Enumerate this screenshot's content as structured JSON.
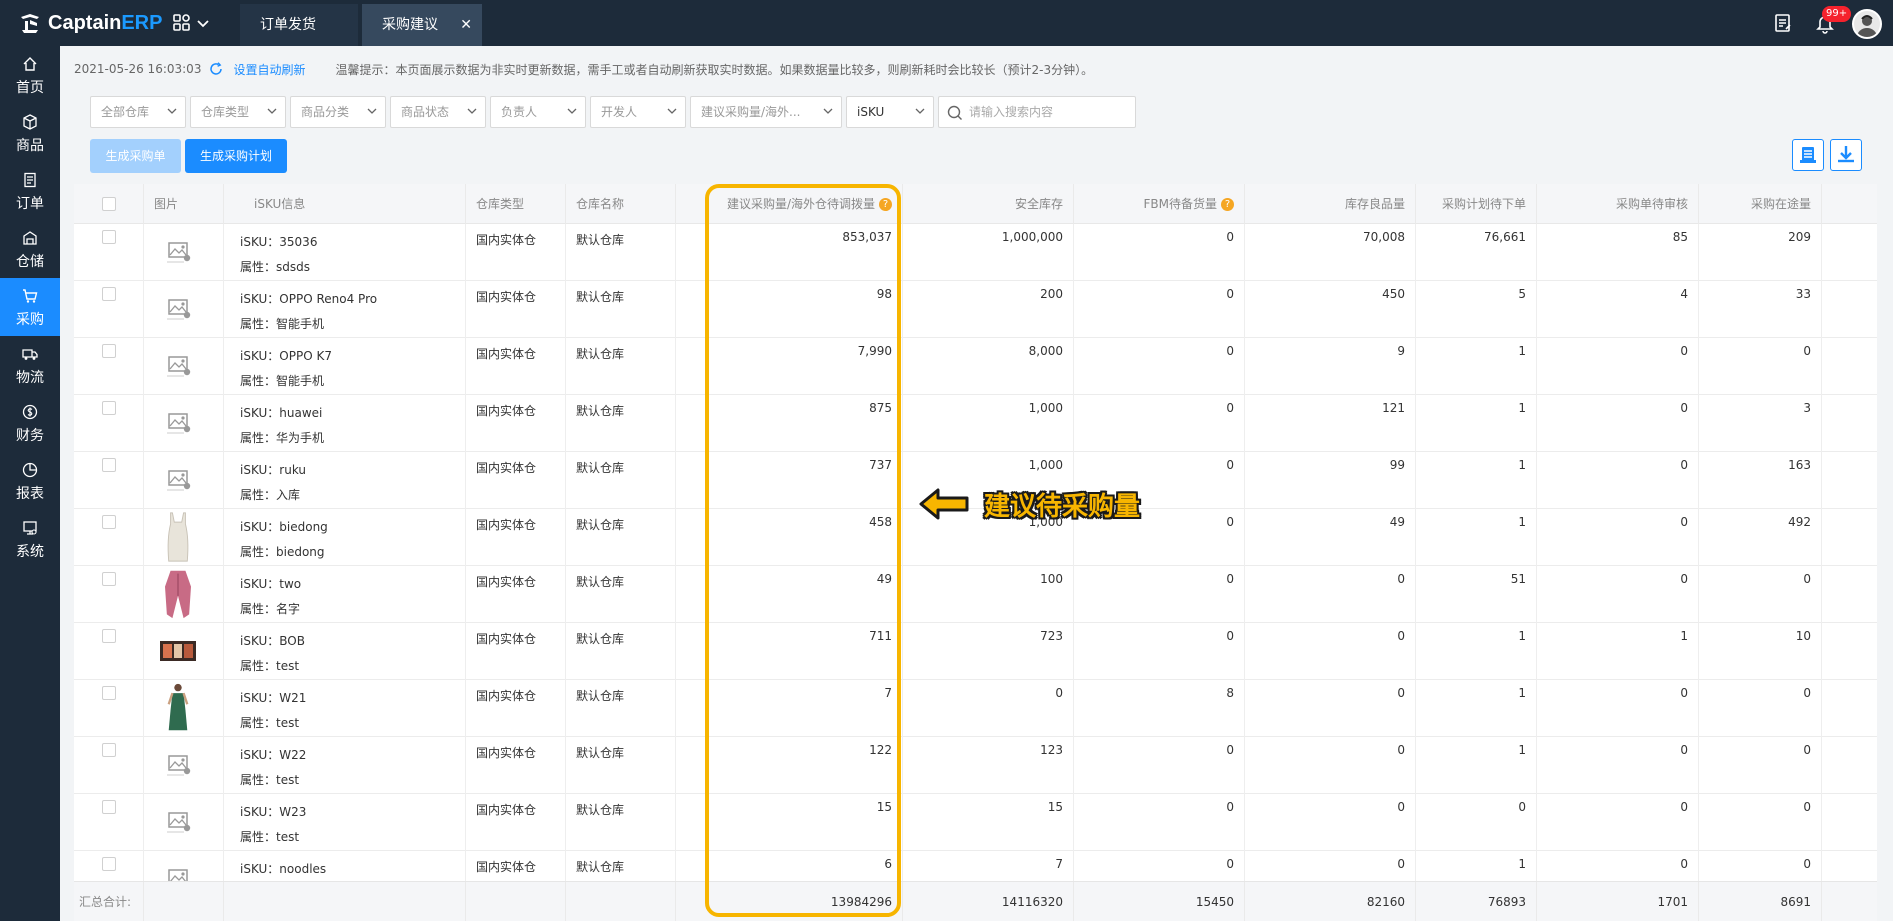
{
  "app": {
    "logo_prefix": "Captain",
    "logo_suffix": "ERP",
    "tabs": [
      {
        "label": "订单发货"
      },
      {
        "label": "采购建议",
        "close": "✕"
      }
    ],
    "notification_badge": "99+"
  },
  "sidebar": {
    "items": [
      {
        "label": "首页",
        "icon": "home-icon"
      },
      {
        "label": "商品",
        "icon": "box-icon"
      },
      {
        "label": "订单",
        "icon": "order-icon"
      },
      {
        "label": "仓储",
        "icon": "warehouse-icon"
      },
      {
        "label": "采购",
        "icon": "cart-icon",
        "active": true
      },
      {
        "label": "物流",
        "icon": "truck-icon"
      },
      {
        "label": "财务",
        "icon": "finance-icon"
      },
      {
        "label": "报表",
        "icon": "report-icon"
      },
      {
        "label": "系统",
        "icon": "system-icon"
      }
    ]
  },
  "infobar": {
    "timestamp": "2021-05-26 16:03:03",
    "auto_refresh": "设置自动刷新",
    "notice": "温馨提示：本页面展示数据为非实时更新数据，需手工或者自动刷新获取实时数据。如果数据量比较多，则刷新耗时会比较长（预计2-3分钟）。"
  },
  "filters": [
    {
      "label": "全部仓库"
    },
    {
      "label": "仓库类型"
    },
    {
      "label": "商品分类"
    },
    {
      "label": "商品状态"
    },
    {
      "label": "负责人"
    },
    {
      "label": "开发人"
    },
    {
      "label": "建议采购量/海外..."
    },
    {
      "label": "iSKU"
    }
  ],
  "search": {
    "placeholder": "请输入搜索内容",
    "value": ""
  },
  "buttons": {
    "generate_po": "生成采购单",
    "generate_plan": "生成采购计划"
  },
  "table": {
    "headers": {
      "image": "图片",
      "isku_info": "iSKU信息",
      "warehouse_type": "仓库类型",
      "warehouse_name": "仓库名称",
      "suggested_qty": "建议采购量/海外仓待调拨量",
      "safety_stock": "安全库存",
      "fbm_pending": "FBM待备货量",
      "good_stock": "库存良品量",
      "plan_pending": "采购计划待下单",
      "po_pending_review": "采购单待审核",
      "in_transit": "采购在途量"
    },
    "rows": [
      {
        "sku": "iSKU：35036",
        "attr": "属性：sdsds",
        "wh_type": "国内实体仓",
        "wh_name": "默认仓库",
        "suggested": "853,037",
        "safety": "1,000,000",
        "fbm": "0",
        "good": "70,008",
        "plan": "76,661",
        "review": "85",
        "transit": "209",
        "thumb": "placeholder"
      },
      {
        "sku": "iSKU：OPPO Reno4 Pro",
        "attr": "属性：智能手机",
        "wh_type": "国内实体仓",
        "wh_name": "默认仓库",
        "suggested": "98",
        "safety": "200",
        "fbm": "0",
        "good": "450",
        "plan": "5",
        "review": "4",
        "transit": "33",
        "thumb": "placeholder"
      },
      {
        "sku": "iSKU：OPPO K7",
        "attr": "属性：智能手机",
        "wh_type": "国内实体仓",
        "wh_name": "默认仓库",
        "suggested": "7,990",
        "safety": "8,000",
        "fbm": "0",
        "good": "9",
        "plan": "1",
        "review": "0",
        "transit": "0",
        "thumb": "placeholder"
      },
      {
        "sku": "iSKU：huawei",
        "attr": "属性：华为手机",
        "wh_type": "国内实体仓",
        "wh_name": "默认仓库",
        "suggested": "875",
        "safety": "1,000",
        "fbm": "0",
        "good": "121",
        "plan": "1",
        "review": "0",
        "transit": "3",
        "thumb": "placeholder"
      },
      {
        "sku": "iSKU：ruku",
        "attr": "属性：入库",
        "wh_type": "国内实体仓",
        "wh_name": "默认仓库",
        "suggested": "737",
        "safety": "1,000",
        "fbm": "0",
        "good": "99",
        "plan": "1",
        "review": "0",
        "transit": "163",
        "thumb": "placeholder"
      },
      {
        "sku": "iSKU：biedong",
        "attr": "属性：biedong",
        "wh_type": "国内实体仓",
        "wh_name": "默认仓库",
        "suggested": "458",
        "safety": "1,000",
        "fbm": "0",
        "good": "49",
        "plan": "1",
        "review": "0",
        "transit": "492",
        "thumb": "tank-top"
      },
      {
        "sku": "iSKU：two",
        "attr": "属性：名字",
        "wh_type": "国内实体仓",
        "wh_name": "默认仓库",
        "suggested": "49",
        "safety": "100",
        "fbm": "0",
        "good": "0",
        "plan": "51",
        "review": "0",
        "transit": "0",
        "thumb": "cardigan"
      },
      {
        "sku": "iSKU：BOB",
        "attr": "属性：test",
        "wh_type": "国内实体仓",
        "wh_name": "默认仓库",
        "suggested": "711",
        "safety": "723",
        "fbm": "0",
        "good": "0",
        "plan": "1",
        "review": "1",
        "transit": "10",
        "thumb": "banner"
      },
      {
        "sku": "iSKU：W21",
        "attr": "属性：test",
        "wh_type": "国内实体仓",
        "wh_name": "默认仓库",
        "suggested": "7",
        "safety": "0",
        "fbm": "8",
        "good": "0",
        "plan": "1",
        "review": "0",
        "transit": "0",
        "thumb": "dress"
      },
      {
        "sku": "iSKU：W22",
        "attr": "属性：test",
        "wh_type": "国内实体仓",
        "wh_name": "默认仓库",
        "suggested": "122",
        "safety": "123",
        "fbm": "0",
        "good": "0",
        "plan": "1",
        "review": "0",
        "transit": "0",
        "thumb": "placeholder"
      },
      {
        "sku": "iSKU：W23",
        "attr": "属性：test",
        "wh_type": "国内实体仓",
        "wh_name": "默认仓库",
        "suggested": "15",
        "safety": "15",
        "fbm": "0",
        "good": "0",
        "plan": "0",
        "review": "0",
        "transit": "0",
        "thumb": "placeholder"
      },
      {
        "sku": "iSKU：noodles",
        "attr": "",
        "wh_type": "国内实体仓",
        "wh_name": "默认仓库",
        "suggested": "6",
        "safety": "7",
        "fbm": "0",
        "good": "0",
        "plan": "1",
        "review": "0",
        "transit": "0",
        "thumb": "placeholder"
      }
    ],
    "footer": {
      "label": "汇总合计:",
      "suggested": "13984296",
      "safety": "14116320",
      "fbm": "15450",
      "good": "82160",
      "plan": "76893",
      "review": "1701",
      "transit": "8691"
    }
  },
  "annotation": {
    "text": "建议待采购量",
    "color": "#f7b500"
  },
  "colors": {
    "primary": "#1b8cff",
    "nav_bg": "#1d2b3a",
    "highlight": "#f7b500"
  }
}
